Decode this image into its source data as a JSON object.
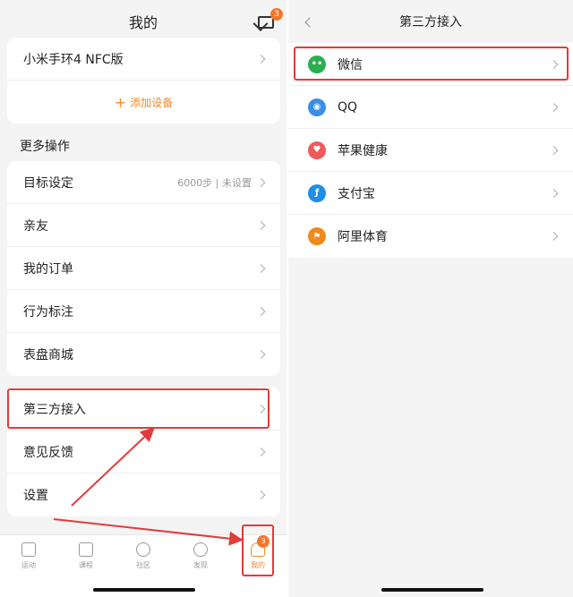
{
  "left": {
    "title": "我的",
    "mail_badge": "3",
    "device_card": {
      "device_name": "小米手环4 NFC版",
      "add_device": "添加设备"
    },
    "section_title": "更多操作",
    "group1": [
      {
        "label": "目标设定",
        "value": "6000步 | 未设置"
      },
      {
        "label": "亲友"
      },
      {
        "label": "我的订单"
      },
      {
        "label": "行为标注"
      },
      {
        "label": "表盘商城"
      }
    ],
    "group2": [
      {
        "label": "第三方接入"
      },
      {
        "label": "意见反馈"
      },
      {
        "label": "设置"
      }
    ],
    "tabs": [
      {
        "label": "运动",
        "icon": "run-icon"
      },
      {
        "label": "课程",
        "icon": "course-icon"
      },
      {
        "label": "社区",
        "icon": "community-icon"
      },
      {
        "label": "发现",
        "icon": "discover-icon"
      },
      {
        "label": "我的",
        "icon": "profile-icon"
      }
    ],
    "tab_badge": "3"
  },
  "right": {
    "title": "第三方接入",
    "items": [
      {
        "label": "微信",
        "icon": "wechat-icon",
        "color": "#2bae4f"
      },
      {
        "label": "QQ",
        "icon": "qq-icon",
        "color": "#3a8ee6"
      },
      {
        "label": "苹果健康",
        "icon": "health-icon",
        "color": "#ef5a5a"
      },
      {
        "label": "支付宝",
        "icon": "alipay-icon",
        "color": "#1e8ee8"
      },
      {
        "label": "阿里体育",
        "icon": "alisports-icon",
        "color": "#f08a1c"
      }
    ]
  },
  "colors": {
    "accent": "#f08a2a",
    "highlight": "#e23b3b",
    "badge": "#f4772e"
  }
}
